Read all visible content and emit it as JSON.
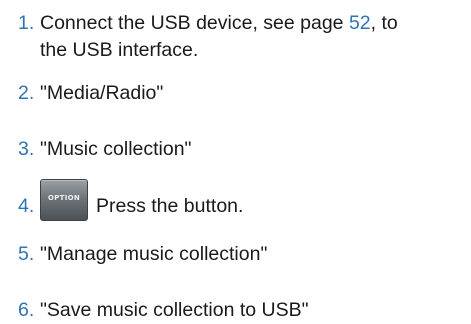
{
  "steps": [
    {
      "number": "1.",
      "line1_before": "Connect the USB device, see page ",
      "page_link": "52",
      "line1_after": ", to",
      "line2": "the USB interface."
    },
    {
      "number": "2.",
      "text": "\"Media/Radio\""
    },
    {
      "number": "3.",
      "text": "\"Music collection\""
    },
    {
      "number": "4.",
      "button_label": "OPTION",
      "text": "Press the button."
    },
    {
      "number": "5.",
      "text": "\"Manage music collection\""
    },
    {
      "number": "6.",
      "text": "\"Save music collection to USB\""
    }
  ],
  "colors": {
    "accent": "#2e74b5",
    "text": "#1a1a1a",
    "button": "#6e747a"
  },
  "icons": {
    "option_button": "option-button-icon"
  }
}
